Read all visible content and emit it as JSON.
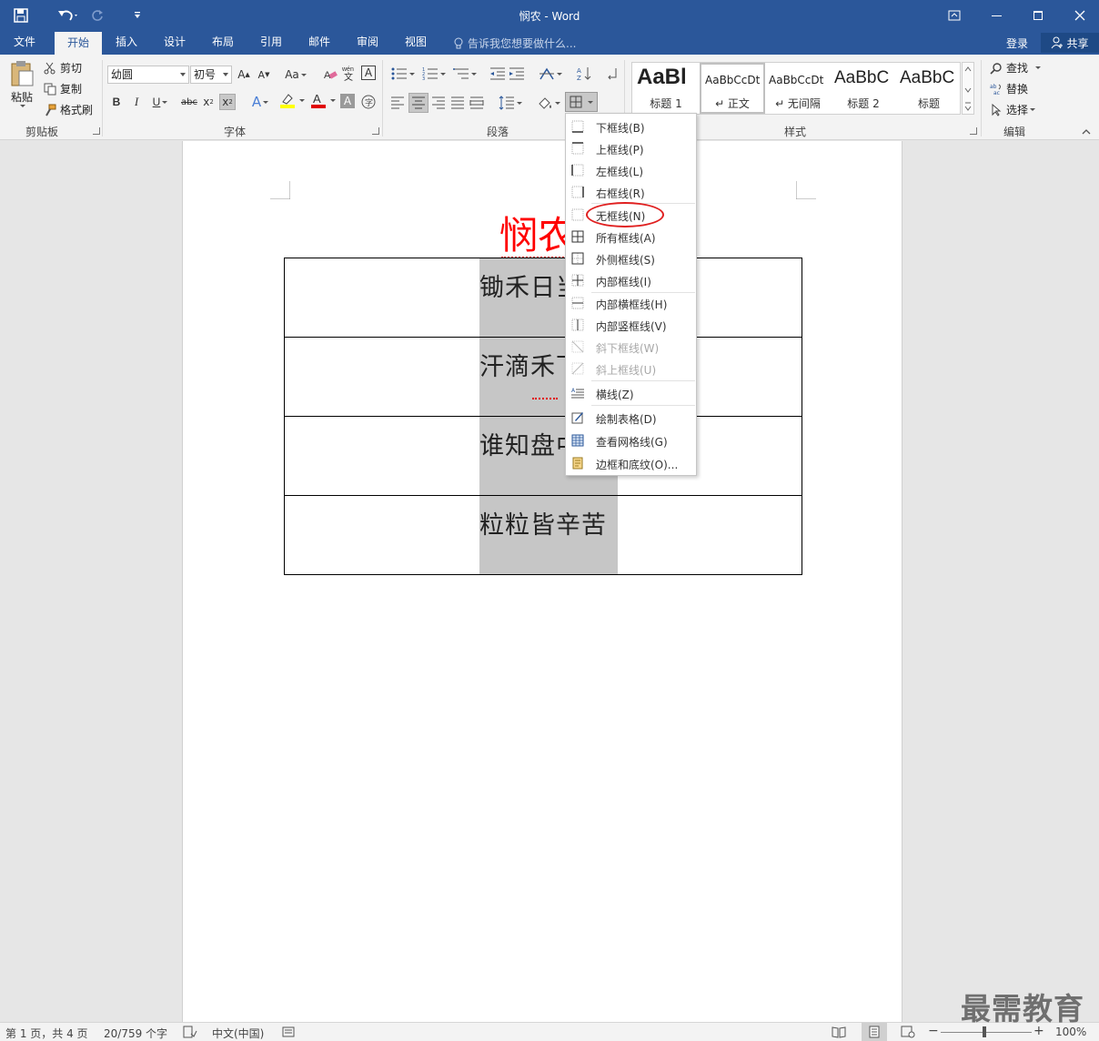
{
  "window": {
    "title": "悯农 - Word",
    "colors": {
      "titlebar": "#2b579a",
      "accent": "#2b579a"
    }
  },
  "tabs": [
    {
      "label": "文件"
    },
    {
      "label": "开始"
    },
    {
      "label": "插入"
    },
    {
      "label": "设计"
    },
    {
      "label": "布局"
    },
    {
      "label": "引用"
    },
    {
      "label": "邮件"
    },
    {
      "label": "审阅"
    },
    {
      "label": "视图"
    }
  ],
  "active_tab": "开始",
  "tell_me": "告诉我您想要做什么...",
  "account": {
    "login": "登录",
    "share": "共享"
  },
  "ribbon": {
    "clipboard": {
      "label": "剪贴板",
      "paste": "粘贴",
      "cut": "剪切",
      "copy": "复制",
      "format_painter": "格式刷"
    },
    "font": {
      "label": "字体",
      "font_name": "幼圆",
      "font_size": "初号"
    },
    "paragraph": {
      "label": "段落"
    },
    "styles": {
      "label": "样式",
      "items": [
        {
          "preview": "AaBl",
          "name": "标题 1"
        },
        {
          "preview": "AaBbCcDt",
          "name": "↵ 正文"
        },
        {
          "preview": "AaBbCcDt",
          "name": "↵ 无间隔"
        },
        {
          "preview": "AaBbC",
          "name": "标题 2"
        },
        {
          "preview": "AaBbC",
          "name": "标题"
        }
      ]
    },
    "editing": {
      "label": "编辑",
      "find": "查找",
      "replace": "替换",
      "select": "选择"
    }
  },
  "document": {
    "title": "悯农",
    "rows": [
      "锄禾日当",
      "汗滴禾下",
      "谁知盘中",
      "粒粒皆辛苦"
    ]
  },
  "border_menu": {
    "items": [
      {
        "label": "下框线(B)",
        "enabled": true
      },
      {
        "label": "上框线(P)",
        "enabled": true
      },
      {
        "label": "左框线(L)",
        "enabled": true
      },
      {
        "label": "右框线(R)",
        "enabled": true
      },
      {
        "label": "无框线(N)",
        "enabled": true,
        "highlighted": true
      },
      {
        "label": "所有框线(A)",
        "enabled": true
      },
      {
        "label": "外侧框线(S)",
        "enabled": true
      },
      {
        "label": "内部框线(I)",
        "enabled": true
      },
      {
        "label": "内部横框线(H)",
        "enabled": true
      },
      {
        "label": "内部竖框线(V)",
        "enabled": true
      },
      {
        "label": "斜下框线(W)",
        "enabled": false
      },
      {
        "label": "斜上框线(U)",
        "enabled": false
      },
      {
        "label": "横线(Z)",
        "enabled": true
      },
      {
        "label": "绘制表格(D)",
        "enabled": true
      },
      {
        "label": "查看网格线(G)",
        "enabled": true
      },
      {
        "label": "边框和底纹(O)...",
        "enabled": true
      }
    ]
  },
  "status": {
    "page": "第 1 页，共 4 页",
    "words": "20/759 个字",
    "language": "中文(中国)",
    "zoom": "100%"
  },
  "watermark": "最需教育"
}
